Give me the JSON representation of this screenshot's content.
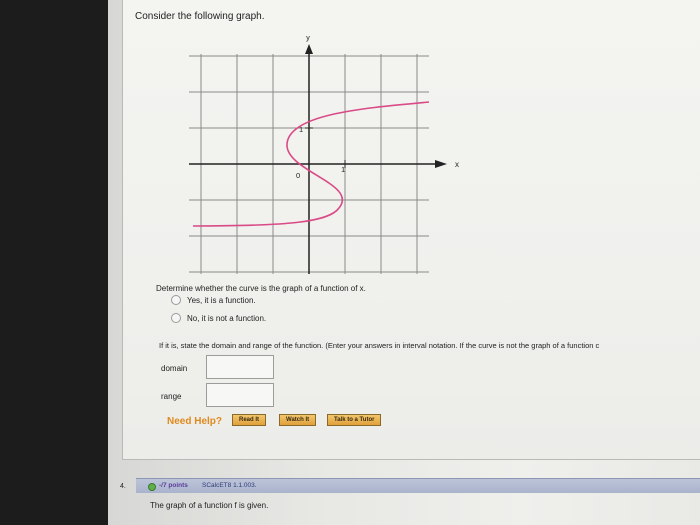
{
  "question": {
    "prompt": "Consider the following graph.",
    "graph": {
      "y_label": "y",
      "x_label": "x",
      "origin_label": "0",
      "tick_label": "1",
      "left_tick_label": "1",
      "curve_color": "#d94a86"
    },
    "determine_text": "Determine whether the curve is the graph of a function of x.",
    "options": [
      {
        "label": "Yes, it is a function."
      },
      {
        "label": "No, it is not a function."
      }
    ],
    "instructions": "If it is, state the domain and range of the function. (Enter your answers in interval notation. If the curve is not the graph of a function c",
    "domain_label": "domain",
    "domain_value": "",
    "range_label": "range",
    "range_value": ""
  },
  "help": {
    "need_help": "Need Help?",
    "read_it": "Read It",
    "watch_it": "Watch It",
    "talk_to_tutor": "Talk to a Tutor"
  },
  "next_question": {
    "number": "4.",
    "points": "-/7 points",
    "source": "SCalcET8 1.1.003.",
    "text": "The graph of a function f is given."
  }
}
